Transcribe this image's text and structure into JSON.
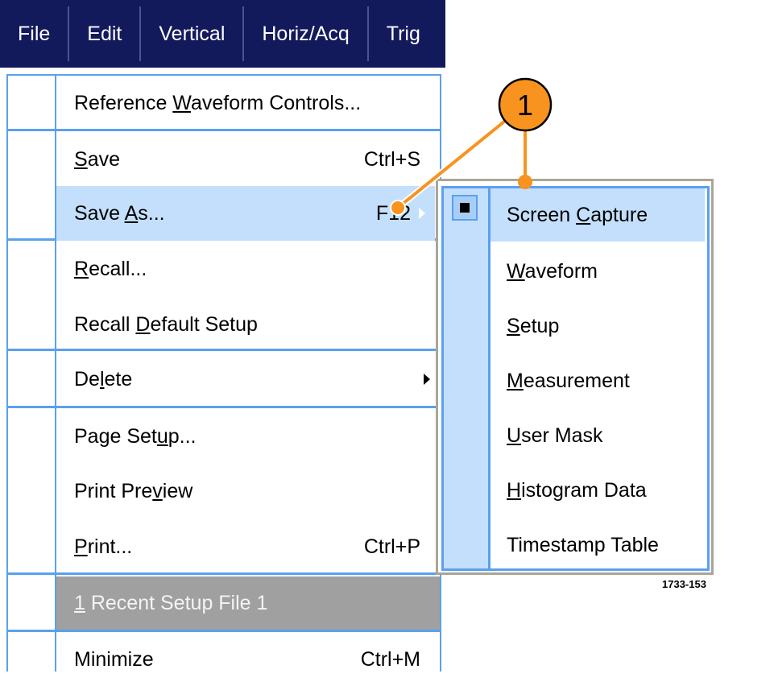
{
  "menubar": [
    "File",
    "Edit",
    "Vertical",
    "Horiz/Acq",
    "Trig"
  ],
  "file_menu": [
    {
      "pre": "Reference ",
      "key": "W",
      "post": "aveform Controls...",
      "shortcut": ""
    },
    {
      "pre": "",
      "key": "S",
      "post": "ave",
      "shortcut": "Ctrl+S"
    },
    {
      "pre": "Save ",
      "key": "A",
      "post": "s...",
      "shortcut": "F12",
      "highlighted": true,
      "submenu": true
    },
    {
      "pre": "",
      "key": "R",
      "post": "ecall...",
      "shortcut": ""
    },
    {
      "pre": "Recall ",
      "key": "D",
      "post": "efault Setup",
      "shortcut": ""
    },
    {
      "pre": "De",
      "key": "l",
      "post": "ete",
      "shortcut": "",
      "submenu": true
    },
    {
      "pre": "Page Set",
      "key": "u",
      "post": "p...",
      "shortcut": ""
    },
    {
      "pre": "Print Pre",
      "key": "v",
      "post": "iew",
      "shortcut": ""
    },
    {
      "pre": "",
      "key": "P",
      "post": "rint...",
      "shortcut": "Ctrl+P"
    },
    {
      "pre": "",
      "key": "1",
      "post": " Recent Setup File 1",
      "shortcut": "",
      "disabled": true
    },
    {
      "pre": "Minimize",
      "key": "",
      "post": "",
      "shortcut": "Ctrl+M"
    }
  ],
  "save_as_submenu": [
    {
      "pre": "Screen ",
      "key": "C",
      "post": "apture",
      "checked": true,
      "highlighted": true
    },
    {
      "pre": "",
      "key": "W",
      "post": "aveform"
    },
    {
      "pre": "",
      "key": "S",
      "post": "etup"
    },
    {
      "pre": "",
      "key": "M",
      "post": "easurement"
    },
    {
      "pre": "",
      "key": "U",
      "post": "ser Mask"
    },
    {
      "pre": "",
      "key": "H",
      "post": "istogram Data"
    },
    {
      "pre": "Timestamp Table",
      "key": "",
      "post": ""
    }
  ],
  "callout": {
    "number": "1",
    "color": "#f7931e"
  },
  "figure_id": "1733-153",
  "colors": {
    "menubar": "#131a5c",
    "highlight": "#c3dffb",
    "border": "#5aa0f0",
    "disabled": "#a0a0a0"
  }
}
